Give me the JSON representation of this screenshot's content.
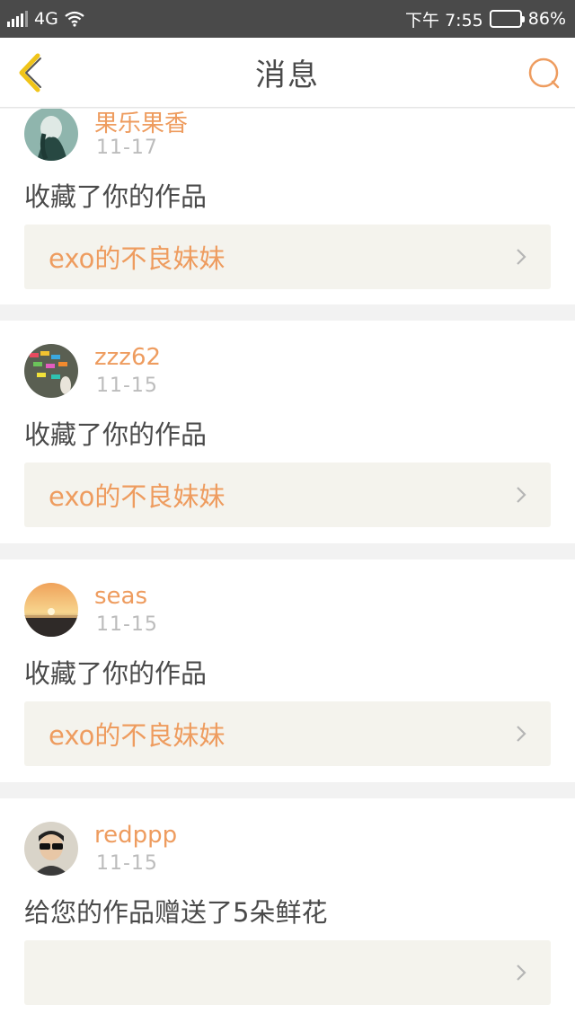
{
  "status_bar": {
    "network": "4G",
    "time": "下午 7:55",
    "battery": "86%",
    "battery_level": 0.86
  },
  "header": {
    "title": "消息"
  },
  "messages": [
    {
      "username": "果乐果香",
      "date": "11-17",
      "action": "收藏了你的作品",
      "work_title": "exo的不良妹妹"
    },
    {
      "username": "zzz62",
      "date": "11-15",
      "action": "收藏了你的作品",
      "work_title": "exo的不良妹妹"
    },
    {
      "username": "seas",
      "date": "11-15",
      "action": "收藏了你的作品",
      "work_title": "exo的不良妹妹"
    },
    {
      "username": "redppp",
      "date": "11-15",
      "action": "给您的作品赠送了5朵鲜花",
      "work_title": ""
    }
  ],
  "colors": {
    "accent": "#ee9c5f",
    "back_icon": "#f0c419",
    "battery_fill": "#39d04a"
  }
}
